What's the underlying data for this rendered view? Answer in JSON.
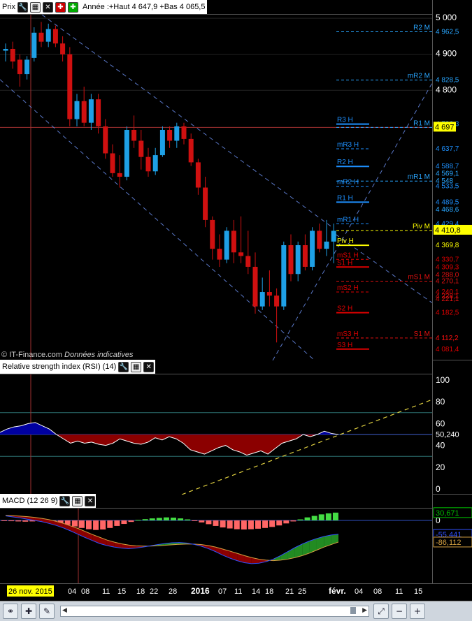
{
  "toolbar_top": {
    "title": "Prix",
    "info": "Année :+Haut 4 647,9 +Bas 4 065,5"
  },
  "copyright": "© IT-Finance.com",
  "disclaimer": "Données indicatives",
  "rsi_panel": {
    "title": "Relative strength index (RSI) (14)"
  },
  "macd_panel": {
    "title": "MACD (12 26 9)"
  },
  "colors": {
    "bull": "#1ea0e6",
    "bear": "#d01010",
    "pivot": "#ffff00",
    "resistance": "#1e90ff",
    "support": "#dd0000",
    "rsi_fill_up": "#0000a0",
    "rsi_fill_down": "#8b0000",
    "macd_pos": "#44dd44",
    "macd_neg": "#ff6666"
  },
  "chart_data": [
    {
      "type": "candlestick",
      "title": "Prix",
      "price_ticks": [
        "5 000",
        "4 900",
        "4 800"
      ],
      "current_price": "4 697",
      "last_price_label": "4 410,8",
      "ylim": [
        4050,
        5010
      ],
      "x_labels": [
        "26 nov. 2015",
        "04",
        "08",
        "11",
        "15",
        "18",
        "22",
        "28",
        "2016",
        "07",
        "11",
        "14",
        "18",
        "21",
        "25",
        "févr.",
        "04",
        "08",
        "11",
        "15"
      ],
      "candles": [
        {
          "o": 4910,
          "h": 4930,
          "l": 4880,
          "c": 4915
        },
        {
          "o": 4915,
          "h": 4935,
          "l": 4860,
          "c": 4880
        },
        {
          "o": 4885,
          "h": 4900,
          "l": 4810,
          "c": 4845
        },
        {
          "o": 4845,
          "h": 4895,
          "l": 4830,
          "c": 4885
        },
        {
          "o": 4890,
          "h": 4975,
          "l": 4880,
          "c": 4960
        },
        {
          "o": 4960,
          "h": 4990,
          "l": 4920,
          "c": 4935
        },
        {
          "o": 4935,
          "h": 4985,
          "l": 4920,
          "c": 4970
        },
        {
          "o": 4970,
          "h": 4980,
          "l": 4920,
          "c": 4930
        },
        {
          "o": 4930,
          "h": 4950,
          "l": 4880,
          "c": 4900
        },
        {
          "o": 4900,
          "h": 4920,
          "l": 4700,
          "c": 4720
        },
        {
          "o": 4720,
          "h": 4790,
          "l": 4700,
          "c": 4770
        },
        {
          "o": 4770,
          "h": 4810,
          "l": 4700,
          "c": 4710
        },
        {
          "o": 4710,
          "h": 4790,
          "l": 4690,
          "c": 4775
        },
        {
          "o": 4775,
          "h": 4790,
          "l": 4680,
          "c": 4700
        },
        {
          "o": 4700,
          "h": 4720,
          "l": 4610,
          "c": 4625
        },
        {
          "o": 4625,
          "h": 4650,
          "l": 4560,
          "c": 4570
        },
        {
          "o": 4570,
          "h": 4620,
          "l": 4530,
          "c": 4560
        },
        {
          "o": 4560,
          "h": 4700,
          "l": 4550,
          "c": 4690
        },
        {
          "o": 4690,
          "h": 4730,
          "l": 4640,
          "c": 4660
        },
        {
          "o": 4660,
          "h": 4690,
          "l": 4580,
          "c": 4615
        },
        {
          "o": 4615,
          "h": 4640,
          "l": 4560,
          "c": 4575
        },
        {
          "o": 4575,
          "h": 4640,
          "l": 4565,
          "c": 4620
        },
        {
          "o": 4620,
          "h": 4700,
          "l": 4615,
          "c": 4690
        },
        {
          "o": 4690,
          "h": 4700,
          "l": 4640,
          "c": 4660
        },
        {
          "o": 4660,
          "h": 4710,
          "l": 4640,
          "c": 4700
        },
        {
          "o": 4700,
          "h": 4710,
          "l": 4650,
          "c": 4665
        },
        {
          "o": 4665,
          "h": 4680,
          "l": 4590,
          "c": 4600
        },
        {
          "o": 4600,
          "h": 4610,
          "l": 4510,
          "c": 4530
        },
        {
          "o": 4530,
          "h": 4560,
          "l": 4420,
          "c": 4440
        },
        {
          "o": 4440,
          "h": 4450,
          "l": 4330,
          "c": 4360
        },
        {
          "o": 4360,
          "h": 4400,
          "l": 4310,
          "c": 4330
        },
        {
          "o": 4330,
          "h": 4420,
          "l": 4320,
          "c": 4410
        },
        {
          "o": 4410,
          "h": 4440,
          "l": 4320,
          "c": 4350
        },
        {
          "o": 4350,
          "h": 4450,
          "l": 4320,
          "c": 4340
        },
        {
          "o": 4340,
          "h": 4410,
          "l": 4290,
          "c": 4310
        },
        {
          "o": 4310,
          "h": 4350,
          "l": 4180,
          "c": 4200
        },
        {
          "o": 4200,
          "h": 4280,
          "l": 4190,
          "c": 4240
        },
        {
          "o": 4240,
          "h": 4300,
          "l": 4200,
          "c": 4230
        },
        {
          "o": 4230,
          "h": 4250,
          "l": 4100,
          "c": 4200
        },
        {
          "o": 4200,
          "h": 4380,
          "l": 4190,
          "c": 4370
        },
        {
          "o": 4370,
          "h": 4400,
          "l": 4270,
          "c": 4290
        },
        {
          "o": 4290,
          "h": 4380,
          "l": 4270,
          "c": 4370
        },
        {
          "o": 4370,
          "h": 4400,
          "l": 4300,
          "c": 4310
        },
        {
          "o": 4310,
          "h": 4420,
          "l": 4300,
          "c": 4410
        },
        {
          "o": 4410,
          "h": 4430,
          "l": 4350,
          "c": 4360
        },
        {
          "o": 4360,
          "h": 4440,
          "l": 4340,
          "c": 4380
        },
        {
          "o": 4380,
          "h": 4430,
          "l": 4320,
          "c": 4410
        }
      ],
      "pivot_levels_h": [
        {
          "label": "R3 H",
          "value": "4 706,3"
        },
        {
          "label": "mR3 H",
          "value": "4 637,7"
        },
        {
          "label": "R2 H",
          "value": "4 588,7"
        },
        {
          "label": "mR2 H",
          "value": "4 533,5"
        },
        {
          "label": "R1 H",
          "value": "4 489,5"
        },
        {
          "label": "mR1 H",
          "value": "4 429,4"
        },
        {
          "label": "Piv H",
          "value": "4 369,8"
        },
        {
          "label": "mS1 H",
          "value": "4 330,7"
        },
        {
          "label": "S1 H",
          "value": "4 309,3"
        },
        {
          "label": "mS2 H",
          "value": "4 240,1"
        },
        {
          "label": "S2 H",
          "value": "4 182,5"
        },
        {
          "label": "mS3 H",
          "value": "4 112,2"
        },
        {
          "label": "S3 H",
          "value": "4 081,4"
        }
      ],
      "pivot_levels_m": [
        {
          "label": "R2 M",
          "value": "4 962,5"
        },
        {
          "label": "mR2 M",
          "value": "4 828,5"
        },
        {
          "label": "R1 M",
          "value": "4 697"
        },
        {
          "label": "mR1 M",
          "value": "4 548"
        },
        {
          "label": "Piv M",
          "value": "4 410,8"
        },
        {
          "label": "mS1 M",
          "value": "4 270,1"
        },
        {
          "label": "S1 M",
          "value": "4 112,2"
        }
      ],
      "axis_extra_values": [
        "4 569,1",
        "4 468,6",
        "4 221,1",
        "4 288,0",
        "4 228,1"
      ]
    },
    {
      "type": "line",
      "title": "Relative strength index (RSI) (14)",
      "ylim": [
        0,
        100
      ],
      "y_ticks": [
        "100",
        "80",
        "60",
        "40",
        "20",
        "0"
      ],
      "last_value": "50,240",
      "levels": [
        70,
        50,
        30
      ],
      "values": [
        52,
        55,
        57,
        58,
        60,
        61,
        58,
        55,
        50,
        46,
        42,
        44,
        42,
        43,
        41,
        40,
        42,
        46,
        44,
        42,
        41,
        43,
        47,
        45,
        48,
        46,
        42,
        36,
        34,
        32,
        35,
        38,
        40,
        36,
        34,
        31,
        33,
        35,
        32,
        37,
        42,
        44,
        46,
        50,
        48,
        50,
        53,
        51,
        50
      ]
    },
    {
      "type": "bar",
      "title": "MACD (12 26 9)",
      "y_ticks": [
        "0"
      ],
      "last_values": [
        "30,671",
        "-55,441",
        "-86,112"
      ],
      "histogram": [
        -2,
        -3,
        -4,
        -5,
        -4,
        -3,
        -5,
        -8,
        -12,
        -18,
        -24,
        -30,
        -35,
        -38,
        -36,
        -30,
        -22,
        -14,
        -6,
        2,
        5,
        8,
        10,
        12,
        11,
        8,
        4,
        -2,
        -8,
        -15,
        -22,
        -28,
        -32,
        -35,
        -36,
        -35,
        -33,
        -30,
        -26,
        -20,
        -12,
        -4,
        4,
        12,
        18,
        24,
        28,
        31
      ],
      "macd_line": [
        18,
        14,
        10,
        5,
        0,
        -5,
        -12,
        -20,
        -30,
        -42,
        -55,
        -68,
        -80,
        -92,
        -100,
        -106,
        -110,
        -112,
        -110,
        -106,
        -101,
        -96,
        -92,
        -89,
        -88,
        -90,
        -95,
        -102,
        -112,
        -124,
        -138,
        -150,
        -160,
        -168,
        -172,
        -170,
        -164,
        -154,
        -140,
        -124,
        -108,
        -94,
        -82,
        -72,
        -64,
        -58,
        -55
      ],
      "signal_line": [
        20,
        19,
        17,
        15,
        12,
        8,
        3,
        -4,
        -12,
        -22,
        -32,
        -44,
        -56,
        -67,
        -78,
        -86,
        -93,
        -98,
        -101,
        -102,
        -102,
        -101,
        -99,
        -97,
        -95,
        -94,
        -94,
        -96,
        -100,
        -106,
        -114,
        -122,
        -131,
        -140,
        -148,
        -154,
        -158,
        -160,
        -158,
        -154,
        -148,
        -140,
        -130,
        -118,
        -106,
        -96,
        -86
      ]
    }
  ]
}
